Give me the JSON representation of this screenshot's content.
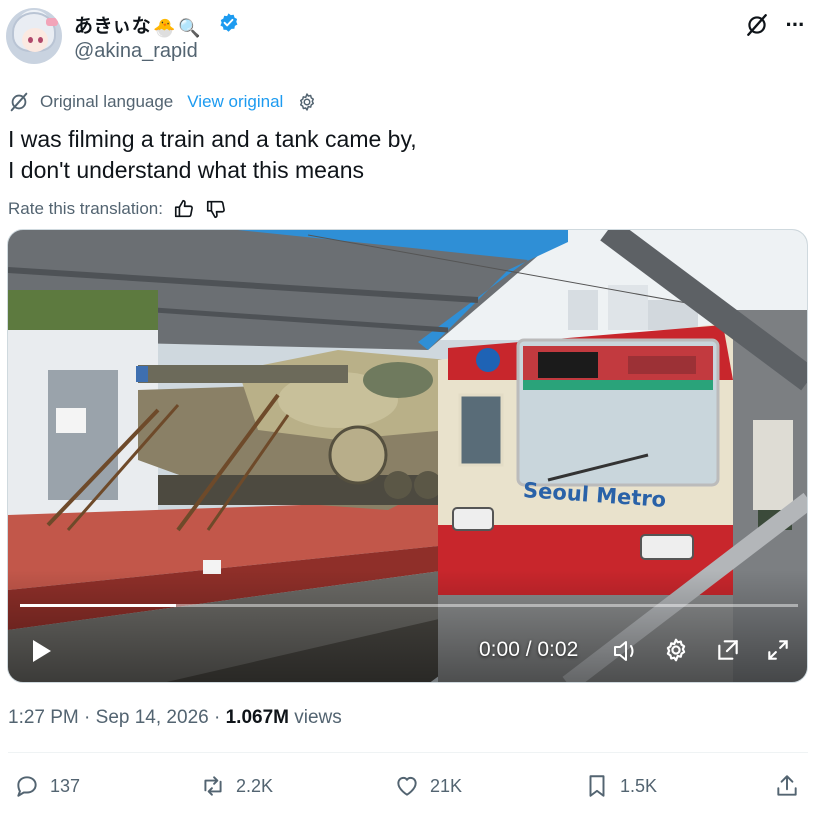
{
  "author": {
    "display_name": "あきぃな",
    "emojis": [
      "🐣",
      "🔍"
    ],
    "handle": "@akina_rapid",
    "verified": true,
    "avatar": "anime-avatar"
  },
  "header_actions": {
    "grok_icon": "grok-icon",
    "more_icon": "more-icon",
    "more_label": "···"
  },
  "translation": {
    "original_language_label": "Original language",
    "view_original_label": "View original",
    "settings_icon": "gear-icon"
  },
  "tweet": {
    "line1": "I was filming a train and a tank came by,",
    "line2": "I don't understand what this means"
  },
  "rate": {
    "label": "Rate this translation:",
    "icons": [
      "thumbs-up-icon",
      "thumbs-down-icon"
    ]
  },
  "video": {
    "train_sign": "Seoul Metro",
    "elapsed": "0:00",
    "duration": "0:02",
    "time_display": "0:00 / 0:02",
    "progress_fraction": 0.2,
    "controls": [
      "play-icon",
      "volume-icon",
      "settings-icon",
      "popout-icon",
      "fullscreen-icon"
    ]
  },
  "meta": {
    "time": "1:27 PM",
    "date": "Sep 14, 2026",
    "views_count": "1.067M",
    "views_label": "views",
    "separator": "·"
  },
  "actions": {
    "replies": "137",
    "reposts": "2.2K",
    "likes": "21K",
    "bookmarks": "1.5K"
  },
  "colors": {
    "link": "#1d9bf0",
    "secondary_text": "#536471",
    "primary_text": "#0f1419",
    "verified": "#1d9bf0",
    "train_red": "#c8262c"
  }
}
